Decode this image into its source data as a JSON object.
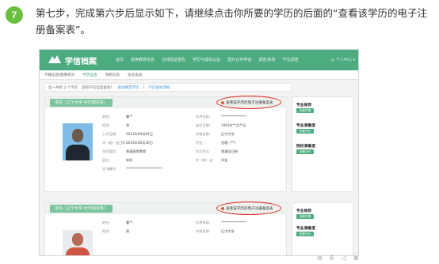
{
  "step": {
    "number": "7",
    "text": "第七步，完成第六步后显示如下，请继续点击你所要的学历的后面的“查看该学历的电子注册备案表”。"
  },
  "site": {
    "logo_text": "学信档案",
    "nav": [
      "首页",
      "高等教育信息",
      "在线验证报告",
      "学历与成绩认证",
      "国外合作申请",
      "调查/投票",
      "毕业调查"
    ],
    "user": "◎ 个人中心 ▾"
  },
  "subnav": [
    "学籍信息/图像校对",
    "学历信息",
    "考研信息",
    "毕业去向"
  ],
  "subnav_active_index": 1,
  "filterbar": {
    "count_text": "您一共有 2 个学历",
    "hint": "还有学历信息查询？",
    "link1": "尝试绑定学历",
    "sep": "|",
    "link2": "学历查询须知"
  },
  "records": [
    {
      "tag": "本科（辽宁大学-全日制本科）",
      "link_text": "查看该学历的电子注册备案表",
      "fields": [
        [
          "姓名：",
          "曹**",
          "证件号码：",
          "***************"
        ],
        [
          "性别：",
          "男",
          "出生日期：",
          "1993年**月**日"
        ],
        [
          "入学日期：",
          "2012年09月01日",
          "学校名称：",
          "辽宁大学"
        ],
        [
          "毕（结）业日期：",
          "2016年06月30日",
          "专业：",
          "金融（**）"
        ],
        [
          "学历类别：",
          "普通高等教育",
          "学习形式：",
          "普通全日制"
        ],
        [
          "层次：",
          "本科",
          "毕（结）业：",
          "毕业"
        ],
        [
          "证书编号：",
          "**********************",
          "",
          ""
        ]
      ]
    },
    {
      "tag": "本科（辽宁大学-全日制本科）",
      "link_text": "查看该学历的电子注册备案表",
      "fields": [
        [
          "姓名：",
          "曹**",
          "证件号码：",
          "***************"
        ],
        [
          "性别：",
          "男",
          "学校名称：",
          "辽宁大学"
        ]
      ]
    }
  ],
  "side1": [
    {
      "title": "专业推荐",
      "button": "查看详情"
    },
    {
      "title": "专业满意度",
      "button": "查看评价"
    },
    {
      "title": "院校满意度",
      "button": "查看评价"
    }
  ],
  "side2": [
    {
      "title": "专业推荐",
      "button": "查看详情"
    },
    {
      "title": "专业满意度",
      "button": "查看评价"
    }
  ],
  "footer_icons": [
    "zoom-out-icon",
    "thumb-icon",
    "audio-icon",
    "zoom-in-icon"
  ],
  "colors": {
    "brand_green": "#4dab80",
    "highlight_red": "#e0201c",
    "badge_green": "#6abf3f"
  }
}
